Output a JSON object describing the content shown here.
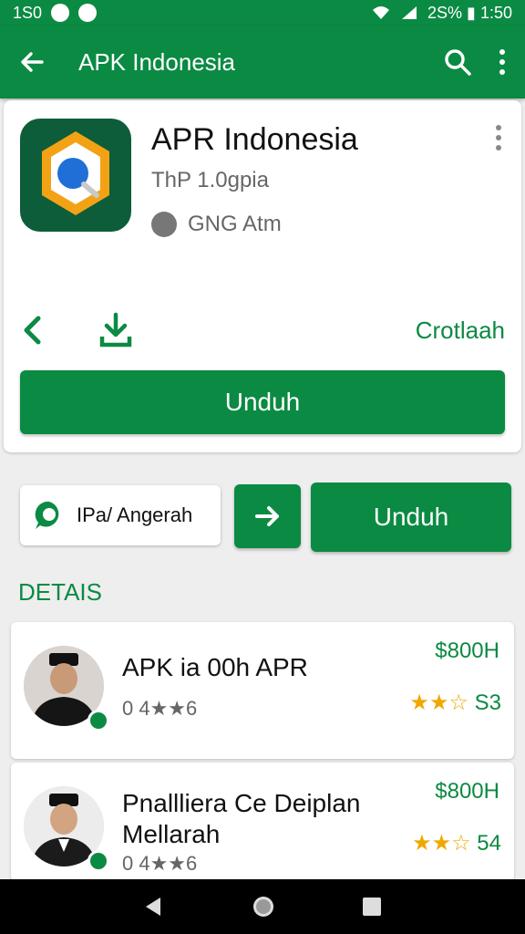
{
  "status": {
    "left": "1S0",
    "right": "2S% ▮ 1:50"
  },
  "appbar": {
    "title": "APK Indonesia"
  },
  "app": {
    "name": "APR Indonesia",
    "developer": "ThP 1.0gpia",
    "meta": "GNG Atm",
    "action_label": "Crotlaah",
    "install_label": "Unduh"
  },
  "chip": {
    "label": "IPa/ Angerah"
  },
  "secondary_button": {
    "label": "Unduh"
  },
  "section": {
    "title": "DETAIS"
  },
  "items": [
    {
      "title": "APK ia 00h APR",
      "sub": "0 4★★6",
      "price": "$800H",
      "stars": "★★☆",
      "rating_num": "S3"
    },
    {
      "title": "Pnallliera Ce Deiplan Mellarah",
      "sub": "0 4★★6",
      "price": "$800H",
      "stars": "★★☆",
      "rating_num": "54"
    }
  ],
  "colors": {
    "accent": "#0b8a43",
    "star": "#f0a800"
  }
}
